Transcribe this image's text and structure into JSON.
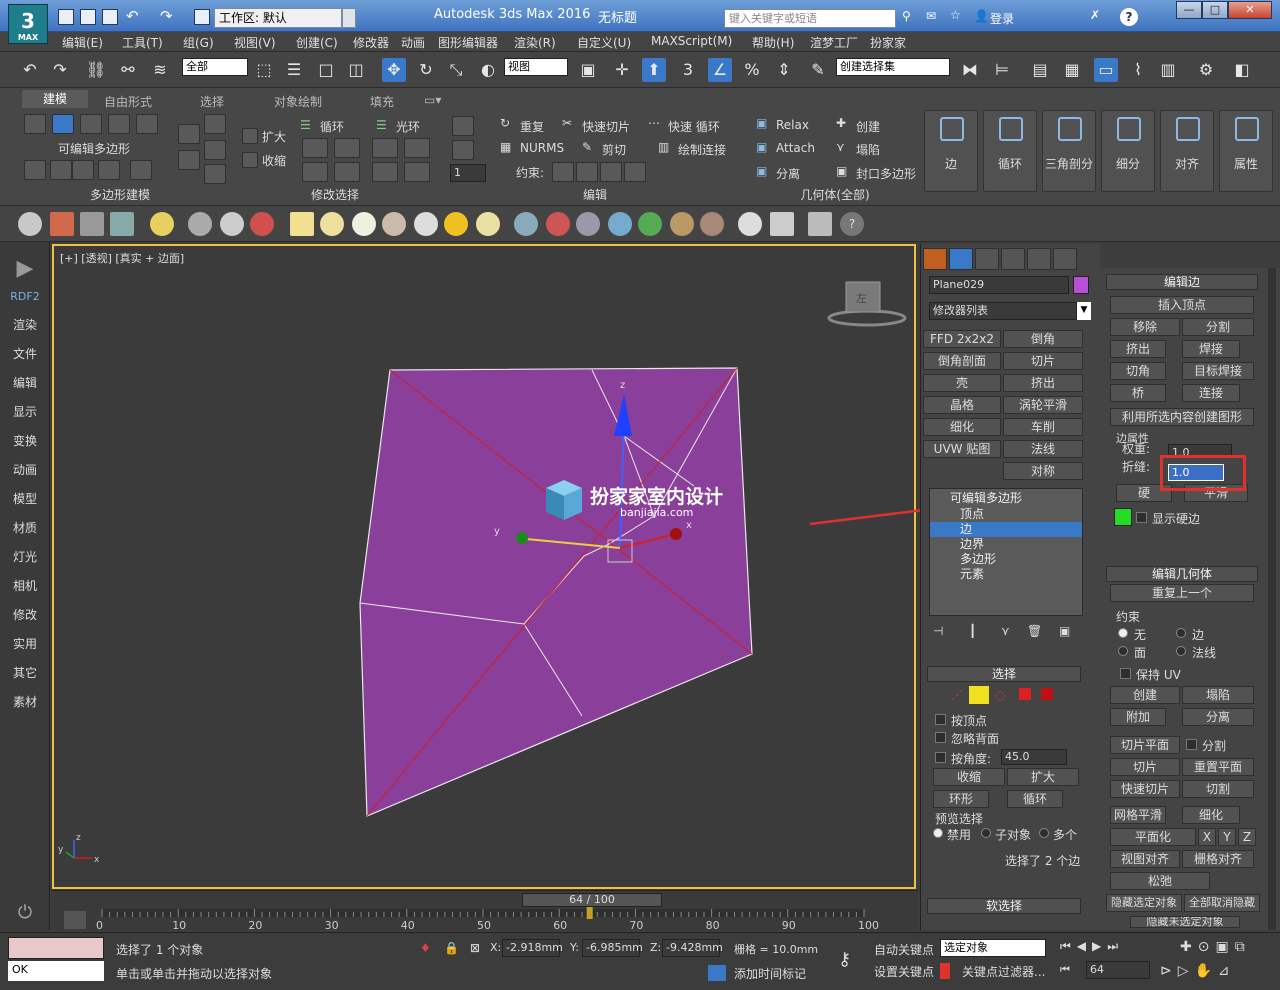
{
  "titlebar": {
    "logo": "3",
    "logo_sub": "MAX",
    "workspace": "工作区: 默认",
    "app_title": "Autodesk 3ds Max 2016",
    "doc_title": "无标题",
    "search_placeholder": "键入关键字或短语",
    "login": "登录",
    "help": "?",
    "min": "—",
    "max": "□",
    "close": "✕"
  },
  "menus": [
    "编辑(E)",
    "工具(T)",
    "组(G)",
    "视图(V)",
    "创建(C)",
    "修改器",
    "动画",
    "图形编辑器",
    "渲染(R)",
    "自定义(U)",
    "MAXScript(M)",
    "帮助(H)",
    "渲梦工厂",
    "扮家家"
  ],
  "toolbar": {
    "filter": "全部",
    "refcoord": "视图",
    "selection_set": "创建选择集",
    "snap_label": "3"
  },
  "ribbon": {
    "tabs": [
      "建模",
      "自由形式",
      "选择",
      "对象绘制",
      "填充"
    ],
    "groups": {
      "poly": "多边形建模",
      "modify_sel": "修改选择",
      "edit": "编辑",
      "geometry": "几何体(全部)"
    },
    "labels": {
      "editable_poly": "可编辑多边形",
      "grow": "扩大",
      "shrink": "收缩",
      "loop": "循环",
      "ring": "光环",
      "repeat": "重复",
      "quickslice": "快速切片",
      "quickloop": "快速 循环",
      "nurms": "NURMS",
      "cut": "剪切",
      "paintconnect": "绘制连接",
      "constraint": "约束:",
      "relax": "Relax",
      "attach": "Attach",
      "detach": "分离",
      "create": "创建",
      "collapse": "塌陷",
      "cap": "封口多边形",
      "spin": "1"
    },
    "big_buttons": [
      "边",
      "循环",
      "三角剖分",
      "细分",
      "对齐",
      "属性"
    ]
  },
  "left_panel": [
    "RDF2",
    "渲染",
    "文件",
    "编辑",
    "显示",
    "变换",
    "动画",
    "模型",
    "材质",
    "灯光",
    "相机",
    "修改",
    "实用",
    "其它",
    "素材"
  ],
  "viewport": {
    "label": "[+] [透视] [真实 + 边面]",
    "watermark": "扮家家室内设计",
    "watermark_sub": "banjiajia.com",
    "viewcube": "左",
    "axis_x": "x",
    "axis_y": "y",
    "axis_z": "z",
    "axis_x2": "x",
    "axis_y2": "y",
    "axis_z2": "z"
  },
  "cmd": {
    "object_name": "Plane029",
    "object_color": "#b94fd6",
    "modifier_list": "修改器列表",
    "modifier_buttons": [
      "FFD 2x2x2",
      "倒角",
      "倒角剖面",
      "切片",
      "壳",
      "挤出",
      "晶格",
      "涡轮平滑",
      "细化",
      "车削",
      "UVW 贴图",
      "法线",
      "",
      "对称"
    ],
    "stack": {
      "root": "可编辑多边形",
      "items": [
        "顶点",
        "边",
        "边界",
        "多边形",
        "元素"
      ],
      "selected_index": 1
    },
    "selection_title": "选择",
    "by_vertex": "按顶点",
    "ignore_backface": "忽略背面",
    "by_angle": "按角度:",
    "angle_value": "45.0",
    "shrink": "收缩",
    "grow": "扩大",
    "ring": "环形",
    "loop": "循环",
    "preview_title": "预览选择",
    "preview_options": [
      "禁用",
      "子对象",
      "多个"
    ],
    "selected_info": "选择了 2 个边",
    "soft_selection": "软选择"
  },
  "edit_edges": {
    "title": "编辑边",
    "insert_vertex": "插入顶点",
    "remove": "移除",
    "split": "分割",
    "extrude": "挤出",
    "weld": "焊接",
    "chamfer": "切角",
    "target_weld": "目标焊接",
    "bridge": "桥",
    "connect": "连接",
    "create_shape": "利用所选内容创建图形",
    "edge_props": "边属性",
    "weight_label": "权重:",
    "weight_value": "1.0",
    "crease_label": "折缝:",
    "crease_value": "1.0",
    "hard": "硬",
    "smooth": "平滑",
    "show_hard": "显示硬边",
    "hard_color": "#22dd22"
  },
  "edit_geometry": {
    "title": "编辑几何体",
    "repeat_last": "重复上一个",
    "constraints": "约束",
    "constraint_options": [
      "无",
      "边",
      "面",
      "法线"
    ],
    "preserve_uv": "保持 UV",
    "create": "创建",
    "collapse": "塌陷",
    "attach": "附加",
    "detach": "分离",
    "slice_plane": "切片平面",
    "split": "分割",
    "slice": "切片",
    "reset_plane": "重置平面",
    "quickslice": "快速切片",
    "cut": "切割",
    "meshsmooth": "网格平滑",
    "tessellate": "细化",
    "planarize": "平面化",
    "x": "X",
    "y": "Y",
    "z": "Z",
    "view_align": "视图对齐",
    "grid_align": "栅格对齐",
    "relax": "松弛",
    "hide_selected": "隐藏选定对象",
    "unhide_all": "全部取消隐藏",
    "hide_unselected": "隐藏未选定对象"
  },
  "timeline": {
    "frame": "64 / 100",
    "current_frame": 64,
    "total_frames": 100,
    "ticks": [
      "0",
      "10",
      "20",
      "30",
      "40",
      "50",
      "60",
      "70",
      "80",
      "90",
      "100"
    ]
  },
  "status": {
    "maxscript": "OK",
    "selected": "选择了 1 个对象",
    "prompt": "单击或单击并拖动以选择对象",
    "x": "-2.918mm",
    "y": "-6.985mm",
    "z": "-9.428mm",
    "grid": "栅格 = 10.0mm",
    "add_time_tag": "添加时间标记",
    "autokey": "自动关键点",
    "setkey": "设置关键点",
    "selected_objects": "选定对象",
    "key_filters": "关键点过滤器...",
    "frame_field": "64"
  }
}
